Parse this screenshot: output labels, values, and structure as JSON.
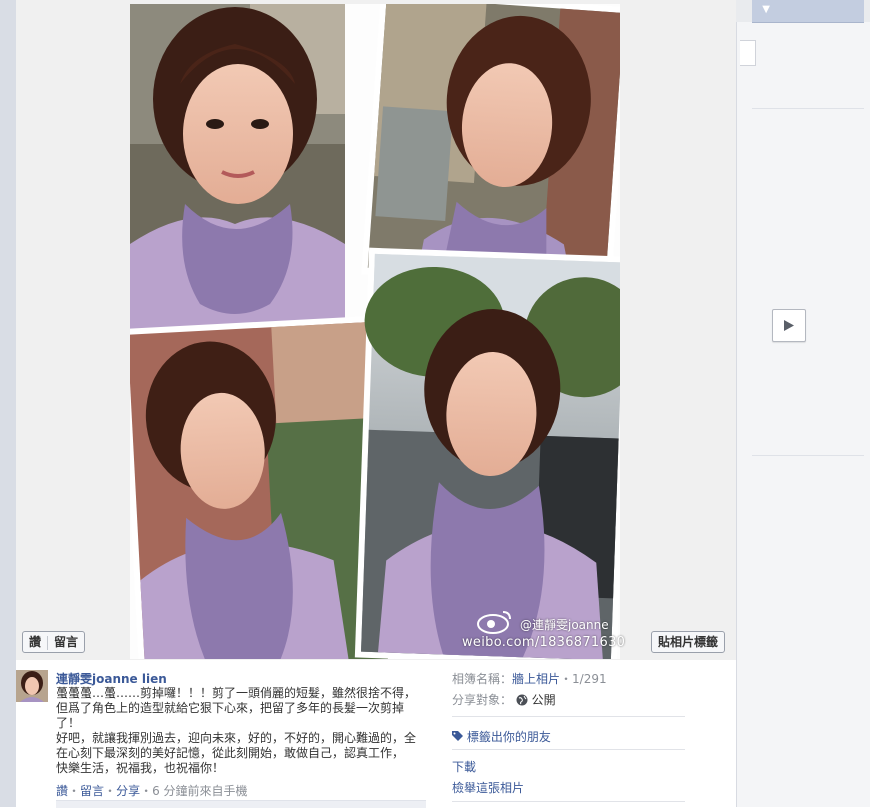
{
  "photo_viewer": {
    "watermark": {
      "name": "@連靜雯joanne",
      "url": "weibo.com/1836871630"
    },
    "left_actions": {
      "like_label": "讚",
      "comment_label": "留言"
    },
    "tag_photo_label": "貼相片標籤"
  },
  "post": {
    "author": "連靜雯joanne lien",
    "caption_line1": "蠆蠆蠆…蠆……剪掉囉！！！剪了一頭俏麗的短髮，雖然很捨不得，但爲了角色上的造型就給它狠下心來，把留了多年的長髮一次剪掉了！",
    "caption_line2": "好吧，就讓我揮別過去，迎向未來，好的，不好的，開心難過的，全在心",
    "caption_line2b": "刻下最深刻的美好記憶，從此刻開始，",
    "caption_line2c": "敢做自己，認真工作，快樂生活，祝福我，也祝福你！",
    "actions": {
      "like": "讚",
      "comment": "留言",
      "share": "分享",
      "time": "6 分鐘前來自手機"
    }
  },
  "details": {
    "album_label": "相簿名稱：",
    "album_value": "牆上相片",
    "album_count": "1/291",
    "share_label": "分享對象：",
    "share_value": "公開",
    "tag_friends": "標籤出你的朋友",
    "download": "下載",
    "report": "檢舉這張相片"
  },
  "icons": {
    "next": "play-next-icon",
    "globe": "globe-icon",
    "tag": "tag-icon",
    "weibo": "weibo-logo-icon"
  },
  "colors": {
    "link": "#3b5998",
    "muted": "#8b8f96",
    "viewer_bg": "#f0f0f0"
  }
}
